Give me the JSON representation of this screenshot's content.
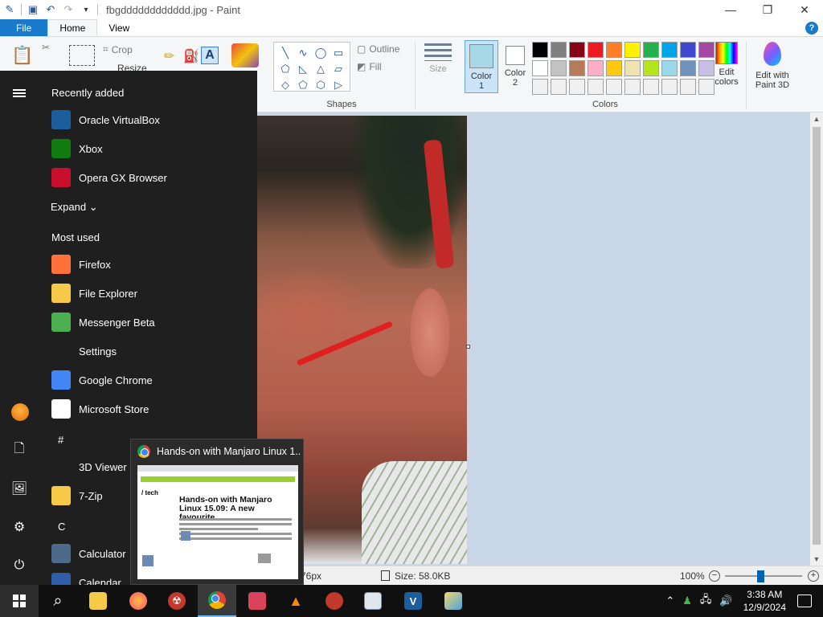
{
  "window": {
    "title": "fbgdddddddddddd.jpg - Paint",
    "minimize": "—",
    "restore": "❐",
    "close": "✕"
  },
  "ribbon": {
    "tabs": [
      "File",
      "Home",
      "View"
    ],
    "crop_label": "Crop",
    "resize_label": "Resize",
    "outline_label": "Outline",
    "fill_label": "Fill",
    "shapes_label": "Shapes",
    "size_label": "Size",
    "color1_label": "Color",
    "color1_num": "1",
    "color2_label": "Color",
    "color2_num": "2",
    "colors_label": "Colors",
    "edit_colors_line1": "Edit",
    "edit_colors_line2": "colors",
    "paint3d_line1": "Edit with",
    "paint3d_line2": "Paint 3D",
    "color1": "#a6d8e8",
    "color2": "#ffffff",
    "palette": [
      "#000000",
      "#7f7f7f",
      "#880015",
      "#ed1c24",
      "#ff7f27",
      "#fff200",
      "#22b14c",
      "#00a2e8",
      "#3f48cc",
      "#a349a4",
      "#ffffff",
      "#c3c3c3",
      "#b97a57",
      "#ffaec9",
      "#ffc90e",
      "#efe4b0",
      "#b5e61d",
      "#99d9ea",
      "#7092be",
      "#c8bfe7",
      "#f0f0f0",
      "#f0f0f0",
      "#f0f0f0",
      "#f0f0f0",
      "#f0f0f0",
      "#f0f0f0",
      "#f0f0f0",
      "#f0f0f0",
      "#f0f0f0",
      "#f0f0f0"
    ]
  },
  "status": {
    "dimensions": "76px",
    "size": "Size: 58.0KB",
    "zoom": "100%",
    "zoom_fraction": 0.46
  },
  "start_menu": {
    "recently_added_title": "Recently added",
    "recent": [
      {
        "label": "Oracle VirtualBox",
        "icon": "virtualbox-icon",
        "color": "#1c5d9c"
      },
      {
        "label": "Xbox",
        "icon": "xbox-icon",
        "color": "#107c10"
      },
      {
        "label": "Opera GX Browser",
        "icon": "opera-gx-icon",
        "color": "#c8102e"
      }
    ],
    "expand_label": "Expand",
    "most_used_title": "Most used",
    "most_used": [
      {
        "label": "Firefox",
        "icon": "firefox-icon",
        "color": "#ff7139"
      },
      {
        "label": "File Explorer",
        "icon": "file-explorer-icon",
        "color": "#f7c948"
      },
      {
        "label": "Messenger Beta",
        "icon": "messenger-icon",
        "color": "#4caf50"
      },
      {
        "label": "Settings",
        "icon": "settings-icon",
        "color": "#1f1f1f"
      },
      {
        "label": "Google Chrome",
        "icon": "chrome-icon",
        "color": "#4285f4"
      },
      {
        "label": "Microsoft Store",
        "icon": "store-icon",
        "color": "#ffffff"
      }
    ],
    "letter_hash": "#",
    "hash_items": [
      {
        "label": "3D Viewer",
        "icon": "3d-viewer-icon",
        "color": "#1f1f1f"
      },
      {
        "label": "7-Zip",
        "icon": "folder-icon",
        "color": "#f7c948"
      }
    ],
    "letter_c": "C",
    "c_items": [
      {
        "label": "Calculator",
        "icon": "calculator-icon",
        "color": "#4c6b8a"
      },
      {
        "label": "Calendar",
        "icon": "calendar-icon",
        "color": "#2f5fa8"
      }
    ]
  },
  "preview": {
    "title": "Hands-on with Manjaro Linux 1...",
    "section": "/ tech",
    "headline": "Hands-on with Manjaro Linux 15.09: A new favourite"
  },
  "taskbar": {
    "time": "3:38 AM",
    "date": "12/9/2024"
  }
}
